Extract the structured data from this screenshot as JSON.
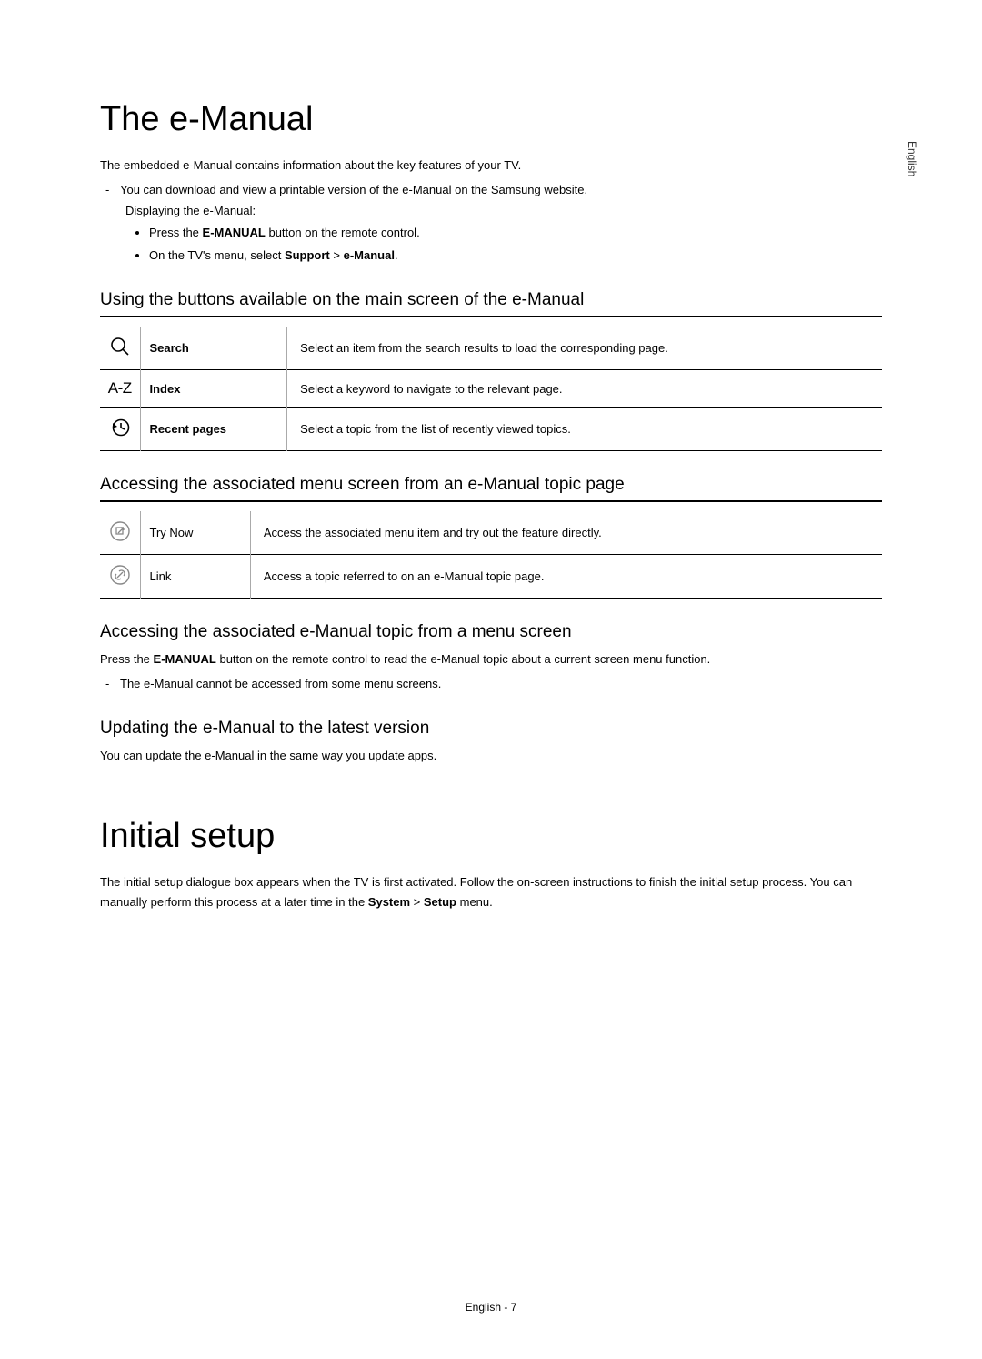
{
  "sideLabel": "English",
  "h1_emanual": "The e-Manual",
  "intro": "The embedded e-Manual contains information about the key features of your TV.",
  "dash1_pre": "You can download and view a printable version of the e-Manual on the Samsung website.",
  "dash1_sub": "Displaying the e-Manual:",
  "bullet1_pre": "Press the ",
  "bullet1_bold": "E-MANUAL",
  "bullet1_post": " button on the remote control.",
  "bullet2_pre": "On the TV's menu, select ",
  "bullet2_b1": "Support",
  "bullet2_mid": " > ",
  "bullet2_b2": "e-Manual",
  "bullet2_post": ".",
  "sec1_title": "Using the buttons available on the main screen of the e-Manual",
  "table1": {
    "r1": {
      "label": "Search",
      "desc": "Select an item from the search results to load the corresponding page."
    },
    "r2": {
      "iconText": "A-Z",
      "label": "Index",
      "desc": "Select a keyword to navigate to the relevant page."
    },
    "r3": {
      "label": "Recent pages",
      "desc": "Select a topic from the list of recently viewed topics."
    }
  },
  "sec2_title": "Accessing the associated menu screen from an e-Manual topic page",
  "table2": {
    "r1": {
      "label": "Try Now",
      "desc": "Access the associated menu item and try out the feature directly."
    },
    "r2": {
      "label": "Link",
      "desc": "Access a topic referred to on an e-Manual topic page."
    }
  },
  "sec3_title": "Accessing the associated e-Manual topic from a menu screen",
  "sec3_p_pre": "Press the ",
  "sec3_p_bold": "E-MANUAL",
  "sec3_p_post": " button on the remote control to read the e-Manual topic about a current screen menu function.",
  "sec3_dash": "The e-Manual cannot be accessed from some menu screens.",
  "sec4_title": "Updating the e-Manual to the latest version",
  "sec4_p": "You can update the e-Manual in the same way you update apps.",
  "h1_initial": "Initial setup",
  "initial_p_pre": "The initial setup dialogue box appears when the TV is first activated. Follow the on-screen instructions to finish the initial setup process. You can manually perform this process at a later time in the ",
  "initial_b1": "System",
  "initial_mid": " > ",
  "initial_b2": "Setup",
  "initial_post": " menu.",
  "footer": "English - 7"
}
